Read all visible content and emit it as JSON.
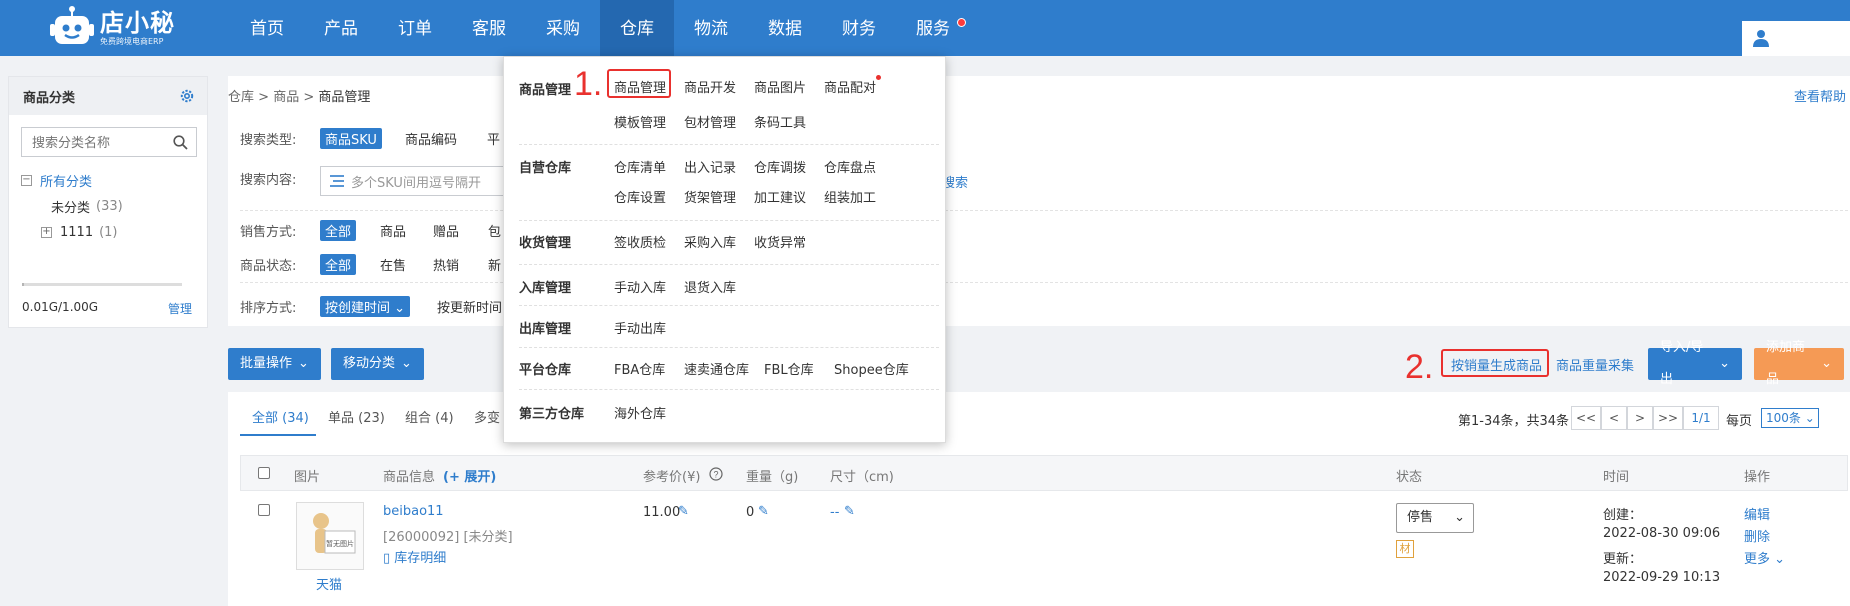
{
  "header": {
    "logo_name": "店小秘",
    "logo_sub": "免费跨境电商ERP",
    "nav": [
      "首页",
      "产品",
      "订单",
      "客服",
      "采购",
      "仓库",
      "物流",
      "数据",
      "财务",
      "服务"
    ],
    "active_nav": "仓库"
  },
  "sidebar": {
    "title": "商品分类",
    "search_placeholder": "搜索分类名称",
    "tree": {
      "root": "所有分类",
      "children": [
        {
          "label": "未分类",
          "count": "(33)"
        },
        {
          "label": "1111",
          "count": "(1)"
        }
      ]
    },
    "quota": "0.01G/1.00G",
    "quota_fraction": 0.01,
    "manage": "管理"
  },
  "breadcrumb": {
    "items": [
      "仓库",
      "商品",
      "商品管理"
    ],
    "help": "查看帮助"
  },
  "filters": {
    "search_type_label": "搜索类型:",
    "search_type_opts": [
      "商品SKU",
      "商品编码",
      "平"
    ],
    "content_label": "搜索内容:",
    "content_placeholder": "多个SKU间用逗号隔开",
    "search_tail": "搜索",
    "sale_label": "销售方式:",
    "sale_opts": [
      "全部",
      "商品",
      "赠品",
      "包"
    ],
    "status_label": "商品状态:",
    "status_opts": [
      "全部",
      "在售",
      "热销",
      "新"
    ],
    "sort_label": "排序方式:",
    "sort_opts": [
      "按创建时间",
      "按更新时间"
    ]
  },
  "actions": {
    "batch": "批量操作",
    "move": "移动分类",
    "gen_by_sales": "按销量生成商品",
    "weight_collect": "商品重量采集",
    "import_export": "导入/导出",
    "add": "添加商品",
    "num2": "2."
  },
  "tabs": [
    "全部 (34)",
    "单品 (23)",
    "组合 (4)",
    "多变"
  ],
  "pager": {
    "summary": "第1-34条，共34条",
    "buttons": [
      "<<",
      "<",
      ">",
      ">>"
    ],
    "page": "1/1",
    "per_label": "每页",
    "per_value": "100条"
  },
  "table": {
    "headers": [
      "图片",
      "商品信息",
      "(+ 展开)",
      "参考价(¥)",
      "重量（g)",
      "尺寸（cm)",
      "状态",
      "时间",
      "操作"
    ],
    "rows": [
      {
        "thumb_text": "暂无图片",
        "platform": "天猫",
        "sku": "beibao11",
        "code": "[26000092] [未分类]",
        "stock_link": "库存明细",
        "price": "11.00",
        "weight": "0",
        "size": "--",
        "status": "停售",
        "tag": "材",
        "created_label": "创建：",
        "created": "2022-08-30 09:06",
        "updated_label": "更新：",
        "updated": "2022-09-29 10:13",
        "ops": [
          "编辑",
          "删除",
          "更多"
        ]
      }
    ]
  },
  "dropdown": {
    "num1": "1.",
    "groups": [
      {
        "title": "商品管理",
        "items": [
          "商品管理",
          "商品开发",
          "商品图片",
          "商品配对",
          "模板管理",
          "包材管理",
          "条码工具"
        ]
      },
      {
        "title": "自营仓库",
        "items": [
          "仓库清单",
          "出入记录",
          "仓库调拨",
          "仓库盘点",
          "仓库设置",
          "货架管理",
          "加工建议",
          "组装加工"
        ]
      },
      {
        "title": "收货管理",
        "items": [
          "签收质检",
          "采购入库",
          "收货异常"
        ]
      },
      {
        "title": "入库管理",
        "items": [
          "手动入库",
          "退货入库"
        ]
      },
      {
        "title": "出库管理",
        "items": [
          "手动出库"
        ]
      },
      {
        "title": "平台仓库",
        "items": [
          "FBA仓库",
          "速卖通仓库",
          "FBL仓库",
          "Shopee仓库"
        ]
      },
      {
        "title": "第三方仓库",
        "items": [
          "海外仓库"
        ]
      }
    ]
  },
  "colors": {
    "primary": "#2f7dcc",
    "orange": "#f59a55",
    "annotation_red": "#e9312e"
  }
}
